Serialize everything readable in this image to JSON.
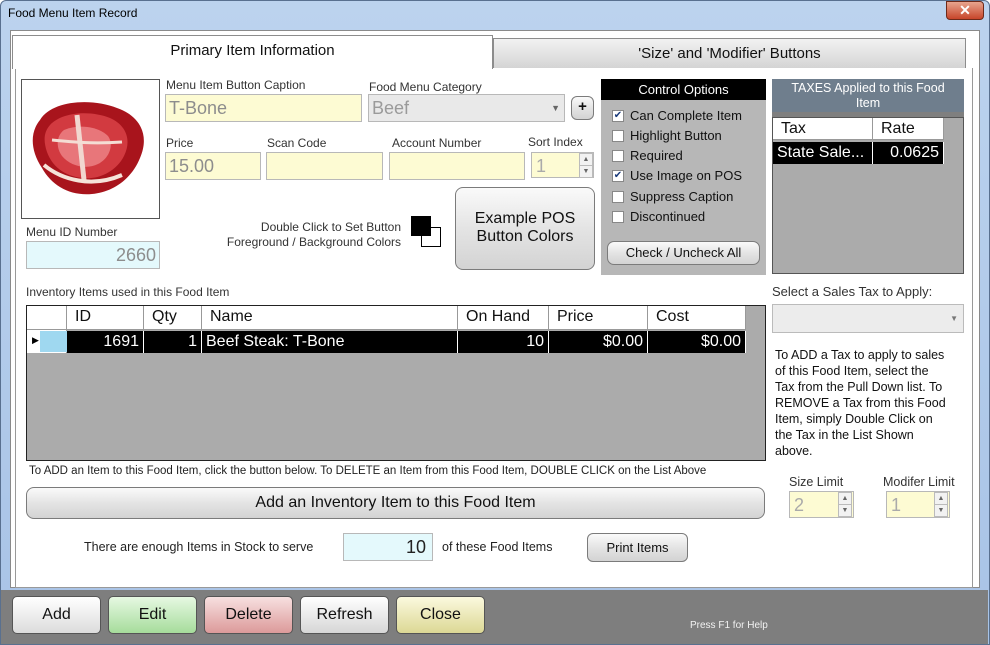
{
  "window": {
    "title": "Food Menu Item Record",
    "close_glyph": "✕"
  },
  "tabs": [
    {
      "label": "Primary Item Information"
    },
    {
      "label": "'Size' and 'Modifier' Buttons"
    }
  ],
  "fields": {
    "caption_label": "Menu Item Button Caption",
    "caption_value": "T-Bone",
    "category_label": "Food Menu Category",
    "category_value": "Beef",
    "add_category": "+",
    "price_label": "Price",
    "price_value": "15.00",
    "scan_label": "Scan Code",
    "scan_value": "",
    "account_label": "Account Number",
    "account_value": "",
    "sort_label": "Sort Index",
    "sort_value": "1",
    "menu_id_label": "Menu ID Number",
    "menu_id_value": "2660",
    "color_hint_line1": "Double Click to Set Button",
    "color_hint_line2": "Foreground / Background Colors",
    "example_line1": "Example POS",
    "example_line2": "Button Colors"
  },
  "control_options": {
    "title": "Control Options",
    "items": [
      {
        "label": "Can Complete Item",
        "checked": true
      },
      {
        "label": "Highlight Button",
        "checked": false
      },
      {
        "label": "Required",
        "checked": false
      },
      {
        "label": "Use Image on POS",
        "checked": true
      },
      {
        "label": "Suppress Caption",
        "checked": false
      },
      {
        "label": "Discontinued",
        "checked": false
      }
    ],
    "toggle_all": "Check / Uncheck All"
  },
  "taxes": {
    "title_line1": "TAXES Applied to this Food",
    "title_line2": "Item",
    "columns": [
      "Tax",
      "Rate"
    ],
    "rows": [
      {
        "tax": "State Sale...",
        "rate": "0.0625"
      }
    ],
    "select_label": "Select a Sales Tax to Apply:",
    "select_value": "",
    "help": [
      "To ADD a Tax to apply to sales",
      "of this Food Item, select the",
      "Tax from the Pull Down list.  To",
      "REMOVE a Tax from this Food",
      "Item, simply Double Click on",
      "the Tax in the List Shown",
      "above."
    ]
  },
  "inventory": {
    "label": "Inventory Items used in this Food Item",
    "columns": [
      "ID",
      "Qty",
      "Name",
      "On Hand",
      "Price",
      "Cost"
    ],
    "rows": [
      {
        "id": "1691",
        "qty": "1",
        "name": "Beef Steak: T-Bone",
        "on_hand": "10",
        "price": "$0.00",
        "cost": "$0.00"
      }
    ],
    "instructions": "To ADD an Item to this Food Item, click the button below.  To DELETE an Item from this Food Item, DOUBLE CLICK on the List Above",
    "add_button": "Add an Inventory Item to this Food Item",
    "stock_text": "There are enough Items in Stock to serve",
    "stock_value": "10",
    "stock_suffix": "of these Food Items",
    "print_button": "Print Items"
  },
  "limits": {
    "size_label": "Size Limit",
    "size_value": "2",
    "modifier_label": "Modifer Limit",
    "modifier_value": "1"
  },
  "bottom": {
    "add": "Add",
    "edit": "Edit",
    "delete": "Delete",
    "refresh": "Refresh",
    "close": "Close",
    "help": "Press F1 for Help"
  },
  "colors": {
    "add": "#f4f4f4",
    "edit": "#bfe7b8",
    "delete": "#e8b0b0",
    "refresh": "#e6e6e6",
    "close": "#ebe8b0",
    "id_field": "#e4f9fc"
  }
}
